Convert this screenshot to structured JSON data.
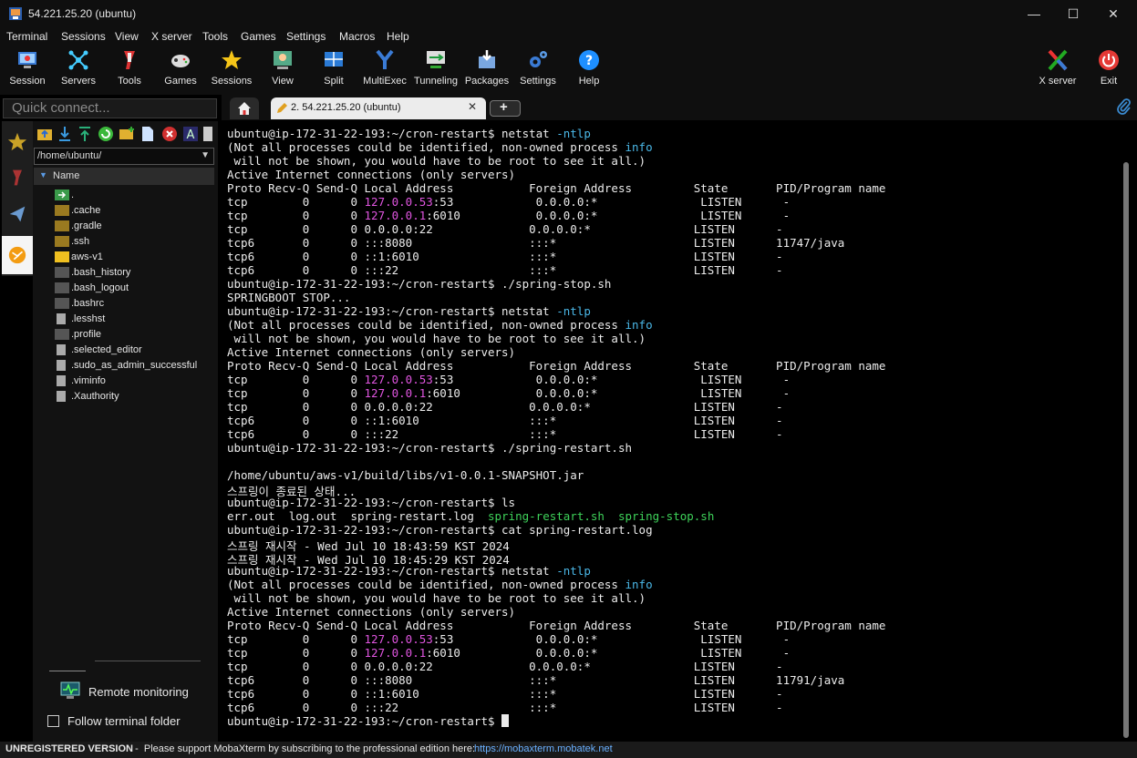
{
  "window": {
    "title": "54.221.25.20 (ubuntu)"
  },
  "menu": [
    "Terminal",
    "Sessions",
    "View",
    "X server",
    "Tools",
    "Games",
    "Settings",
    "Macros",
    "Help"
  ],
  "toolbar": {
    "session": "Session",
    "servers": "Servers",
    "tools": "Tools",
    "games": "Games",
    "sessions": "Sessions",
    "view": "View",
    "split": "Split",
    "multiexec": "MultiExec",
    "tunneling": "Tunneling",
    "packages": "Packages",
    "settings": "Settings",
    "help": "Help",
    "xserver": "X server",
    "exit": "Exit"
  },
  "quick_connect": {
    "placeholder": "Quick connect..."
  },
  "sftp": {
    "path": "/home/ubuntu/",
    "column": "Name",
    "items": [
      ".",
      ".cache",
      ".gradle",
      ".ssh",
      "aws-v1",
      ".bash_history",
      ".bash_logout",
      ".bashrc",
      ".lesshst",
      ".profile",
      ".selected_editor",
      ".sudo_as_admin_successful",
      ".viminfo",
      ".Xauthority"
    ],
    "remote_monitoring": "Remote monitoring",
    "follow_folder": "Follow terminal folder"
  },
  "tabs": {
    "session_tab": "2. 54.221.25.20 (ubuntu)"
  },
  "terminal": {
    "l1": "ubuntu@ip-172-31-22-193:~/cron-restart$ netstat ",
    "l1b": "-ntlp",
    "l2": "(Not all processes could be identified, non-owned process ",
    "l2b": "info",
    "l3": " will not be shown, you would have to be root to see it all.)",
    "l4": "Active Internet connections (only servers)",
    "l5": "Proto Recv-Q Send-Q Local Address           Foreign Address         State       PID/Program name",
    "l6a": "tcp        0      0 ",
    "l6b": "127.0.0.53",
    "l6c": ":53            0.0.0.0:*               LISTEN      -",
    "l7a": "tcp        0      0 ",
    "l7b": "127.0.0.1",
    "l7c": ":6010           0.0.0.0:*               LISTEN      -",
    "l8": "tcp        0      0 0.0.0.0:22              0.0.0.0:*               LISTEN      -",
    "l9": "tcp6       0      0 :::8080                 :::*                    LISTEN      11747/java",
    "l10": "tcp6       0      0 ::1:6010                :::*                    LISTEN      -",
    "l11": "tcp6       0      0 :::22                   :::*                    LISTEN      -",
    "l12": "ubuntu@ip-172-31-22-193:~/cron-restart$ ./spring-stop.sh",
    "l13": "SPRINGBOOT STOP...",
    "l14": "ubuntu@ip-172-31-22-193:~/cron-restart$ netstat ",
    "l14b": "-ntlp",
    "l15": "(Not all processes could be identified, non-owned process ",
    "l15b": "info",
    "l16": " will not be shown, you would have to be root to see it all.)",
    "l17": "Active Internet connections (only servers)",
    "l18": "Proto Recv-Q Send-Q Local Address           Foreign Address         State       PID/Program name",
    "l19a": "tcp        0      0 ",
    "l19b": "127.0.0.53",
    "l19c": ":53            0.0.0.0:*               LISTEN      -",
    "l20a": "tcp        0      0 ",
    "l20b": "127.0.0.1",
    "l20c": ":6010           0.0.0.0:*               LISTEN      -",
    "l21": "tcp        0      0 0.0.0.0:22              0.0.0.0:*               LISTEN      -",
    "l22": "tcp6       0      0 ::1:6010                :::*                    LISTEN      -",
    "l23": "tcp6       0      0 :::22                   :::*                    LISTEN      -",
    "l24": "ubuntu@ip-172-31-22-193:~/cron-restart$ ./spring-restart.sh",
    "l26": "/home/ubuntu/aws-v1/build/libs/v1-0.0.1-SNAPSHOT.jar",
    "l27": "스프링이 종료된 상태...",
    "l28": "ubuntu@ip-172-31-22-193:~/cron-restart$ ls",
    "l29a": "err.out  log.out  spring-restart.log  ",
    "l29b": "spring-restart.sh",
    "l29c": "  ",
    "l29d": "spring-stop.sh",
    "l30": "ubuntu@ip-172-31-22-193:~/cron-restart$ cat spring-restart.log",
    "l31": "스프링 재시작 - Wed Jul 10 18:43:59 KST 2024",
    "l32": "스프링 재시작 - Wed Jul 10 18:45:29 KST 2024",
    "l33": "ubuntu@ip-172-31-22-193:~/cron-restart$ netstat ",
    "l33b": "-ntlp",
    "l34": "(Not all processes could be identified, non-owned process ",
    "l34b": "info",
    "l35": " will not be shown, you would have to be root to see it all.)",
    "l36": "Active Internet connections (only servers)",
    "l37": "Proto Recv-Q Send-Q Local Address           Foreign Address         State       PID/Program name",
    "l38a": "tcp        0      0 ",
    "l38b": "127.0.0.53",
    "l38c": ":53            0.0.0.0:*               LISTEN      -",
    "l39a": "tcp        0      0 ",
    "l39b": "127.0.0.1",
    "l39c": ":6010           0.0.0.0:*               LISTEN      -",
    "l40": "tcp        0      0 0.0.0.0:22              0.0.0.0:*               LISTEN      -",
    "l41": "tcp6       0      0 :::8080                 :::*                    LISTEN      11791/java",
    "l42": "tcp6       0      0 ::1:6010                :::*                    LISTEN      -",
    "l43": "tcp6       0      0 :::22                   :::*                    LISTEN      -",
    "l44": "ubuntu@ip-172-31-22-193:~/cron-restart$ "
  },
  "status": {
    "unregistered": "UNREGISTERED VERSION",
    "message": "  -  Please support MobaXterm by subscribing to the professional edition here: ",
    "link": "https://mobaxterm.mobatek.net"
  },
  "colors": {
    "accent_cyan": "#4bb8e8",
    "ip_magenta": "#e055e0",
    "exec_green": "#3ed35a",
    "link_blue": "#6ab0ff"
  }
}
